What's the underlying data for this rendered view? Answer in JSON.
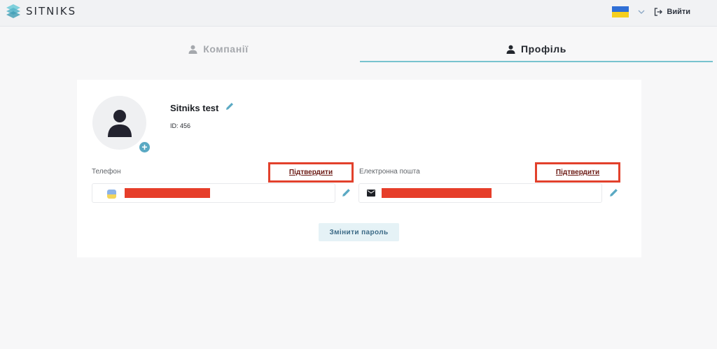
{
  "header": {
    "brand": "SITNIKS",
    "logout_label": "Вийти",
    "language_flag": "ukraine-flag-icon"
  },
  "tabs": [
    {
      "label": "Компанії",
      "active": false,
      "icon": "person-icon"
    },
    {
      "label": "Профіль",
      "active": true,
      "icon": "person-icon"
    }
  ],
  "profile": {
    "name": "Sitniks test",
    "id_text": "ID: 456",
    "phone": {
      "label": "Телефон",
      "confirm_label": "Підтвердити",
      "value_redacted": true
    },
    "email": {
      "label": "Електронна пошта",
      "confirm_label": "Підтвердити",
      "value_redacted": true
    },
    "change_password_label": "Змінити пароль"
  },
  "colors": {
    "accent": "#5aa9c3",
    "tab_underline": "#78c3cf",
    "highlight_red": "#e2412c",
    "redaction_red": "#e63e2a"
  }
}
